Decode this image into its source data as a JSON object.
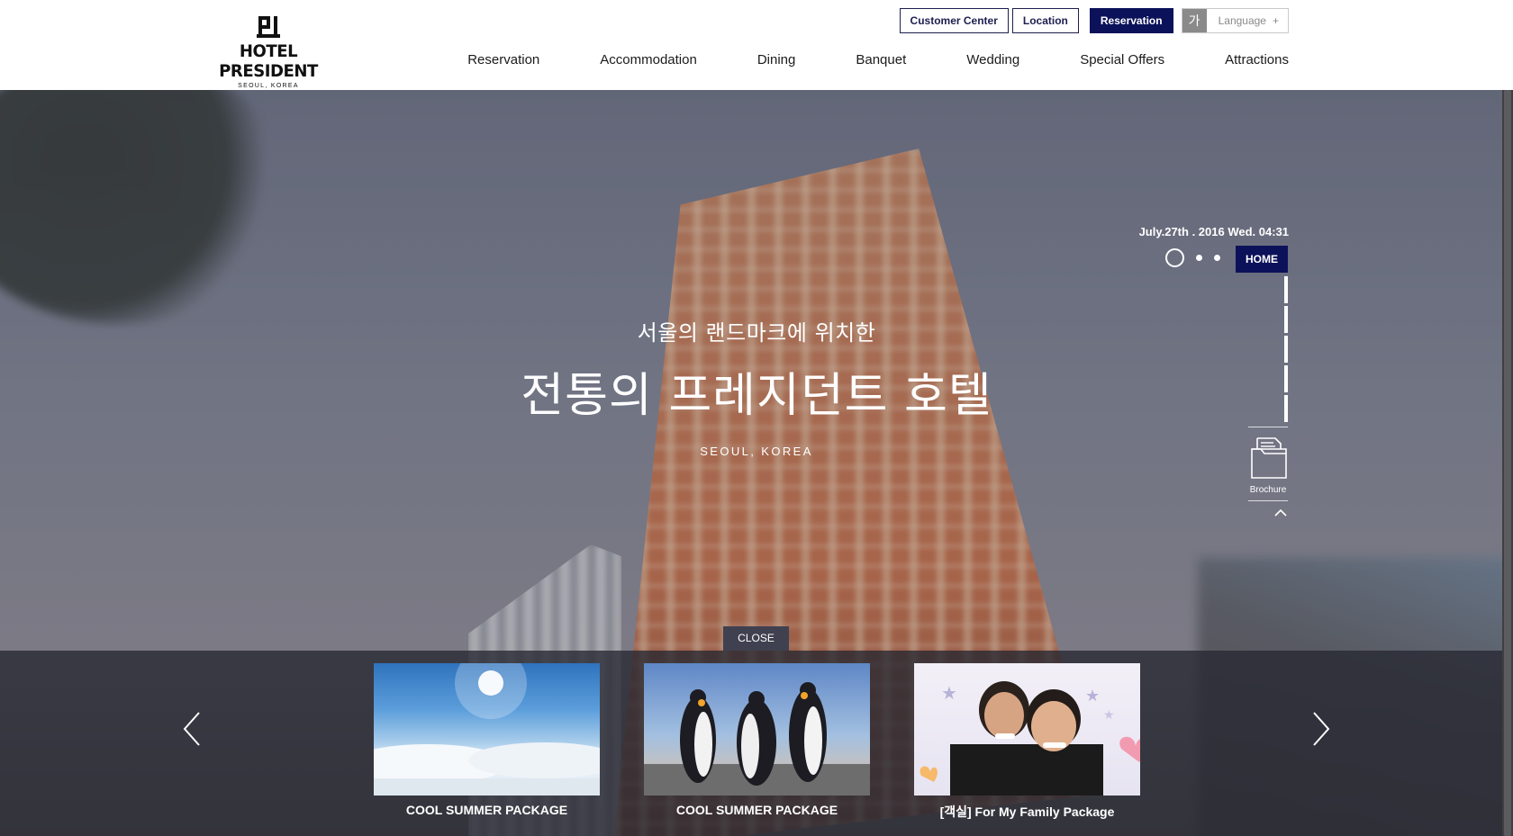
{
  "logo": {
    "name": "HOTEL PRESIDENT",
    "tagline": "SEOUL, KOREA"
  },
  "utility": {
    "customer_center": "Customer Center",
    "location": "Location",
    "reservation": "Reservation",
    "language_badge": "가",
    "language_label": "Language",
    "language_plus": "+"
  },
  "nav": [
    "Reservation",
    "Accommodation",
    "Dining",
    "Banquet",
    "Wedding",
    "Special Offers",
    "Attractions"
  ],
  "hero": {
    "subtitle": "서울의 랜드마크에 위치한",
    "title": "전통의 프레지던트 호텔",
    "location": "SEOUL, KOREA"
  },
  "widget": {
    "datetime": "July.27th . 2016 Wed. 04:31",
    "home": "HOME",
    "brochure": "Brochure",
    "slide_count": 3,
    "active_slide": 1
  },
  "drawer": {
    "close": "CLOSE",
    "packages": [
      {
        "label": "COOL SUMMER PACKAGE",
        "image": "sunny-sky-photo"
      },
      {
        "label": "COOL SUMMER PACKAGE",
        "image": "penguins-photo"
      },
      {
        "label": "[객실] For My Family Package",
        "image": "family-couple-photo"
      }
    ]
  },
  "colors": {
    "brand_navy": "#0c1259",
    "drawer_bg": "#262832"
  }
}
